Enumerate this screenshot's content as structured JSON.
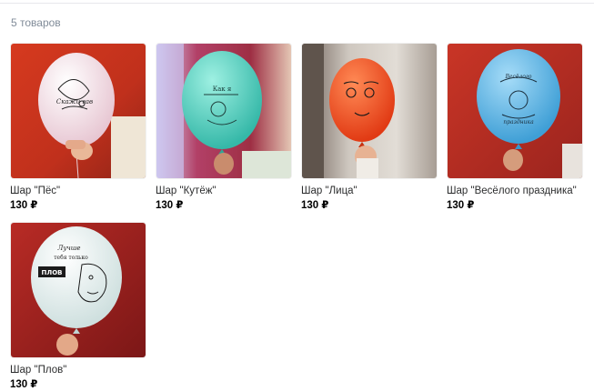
{
  "header": {
    "count": "5 товаров"
  },
  "products": [
    {
      "title": "Шар \"Пёс\"",
      "price": "130 ₽",
      "balloon_color": "#f4e4ea",
      "bg": "#c8321f",
      "print": "Скажи гав"
    },
    {
      "title": "Шар \"Кутёж\"",
      "price": "130 ₽",
      "balloon_color": "#5fcfc0",
      "bg": "#b83a47",
      "print": "Как я"
    },
    {
      "title": "Шар \"Лица\"",
      "price": "130 ₽",
      "balloon_color": "#f1451f",
      "bg": "#b8b4ae",
      "print": ""
    },
    {
      "title": "Шар \"Весёлого праздника\"",
      "price": "130 ₽",
      "balloon_color": "#5bb3e3",
      "bg": "#b32b2a",
      "print": "Весёлого праздника"
    },
    {
      "title": "Шар \"Плов\"",
      "price": "130 ₽",
      "balloon_color": "#eaf2f1",
      "bg": "#a42422",
      "print": "Лучше тебя только ПЛОВ"
    }
  ]
}
